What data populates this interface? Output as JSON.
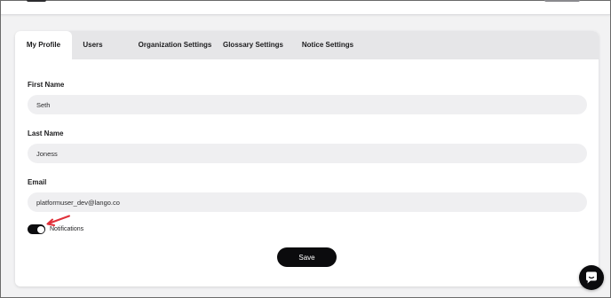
{
  "tabs": [
    {
      "label": "My Profile",
      "active": true
    },
    {
      "label": "Users",
      "active": false
    },
    {
      "label": "Organization Settings",
      "active": false
    },
    {
      "label": "Glossary Settings",
      "active": false
    },
    {
      "label": "Notice Settings",
      "active": false
    }
  ],
  "form": {
    "first_name": {
      "label": "First Name",
      "value": "Seth"
    },
    "last_name": {
      "label": "Last Name",
      "value": "Joness"
    },
    "email": {
      "label": "Email",
      "value": "platformuser_dev@lango.co"
    },
    "notifications": {
      "label": "Notifications",
      "enabled": true
    },
    "save_label": "Save"
  },
  "annotation": {
    "color": "#e0303a",
    "icon": "arrow-icon"
  },
  "chat": {
    "icon": "chat-bubble-icon"
  }
}
